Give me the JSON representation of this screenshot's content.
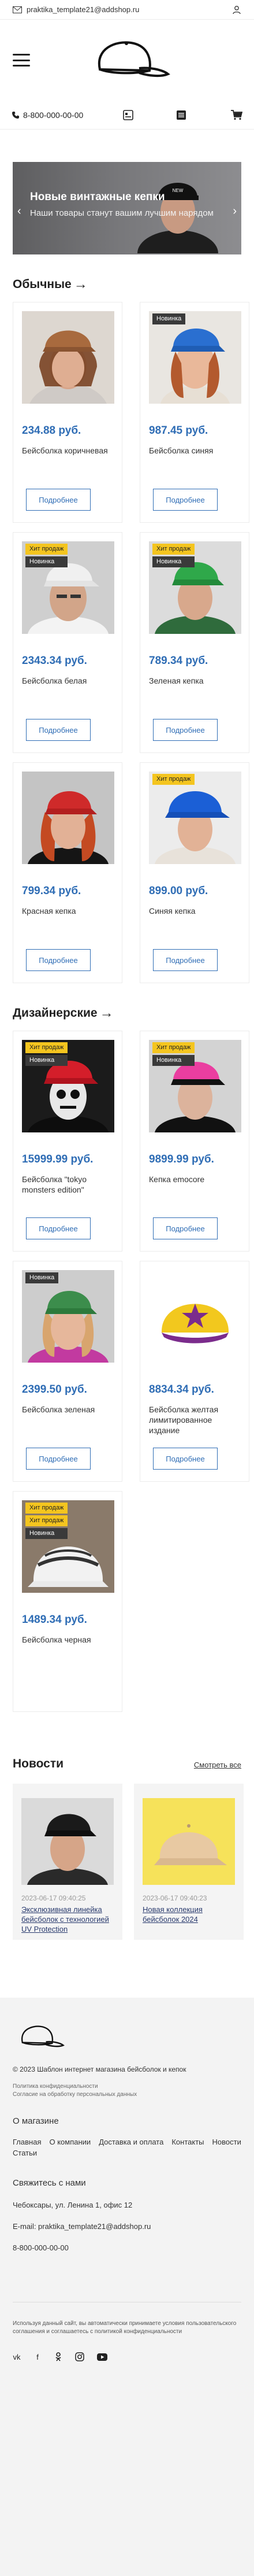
{
  "topbar": {
    "email": "praktika_template21@addshop.ru"
  },
  "header": {
    "phone": "8-800-000-00-00"
  },
  "banner": {
    "title": "Новые винтажные кепки",
    "subtitle": "Наши товары станут вашим лучшим нарядом"
  },
  "sections": {
    "regular_title": "Обычные",
    "designer_title": "Дизайнерские"
  },
  "labels": {
    "more": "Подробнее",
    "new": "Новинка",
    "hit": "Хит продаж"
  },
  "regular_products": [
    {
      "price": "234.88 руб.",
      "name": "Бейсболка коричневая"
    },
    {
      "price": "987.45 руб.",
      "name": "Бейсболка синяя"
    },
    {
      "price": "2343.34 руб.",
      "name": "Бейсболка белая"
    },
    {
      "price": "789.34 руб.",
      "name": "Зеленая кепка"
    },
    {
      "price": "799.34 руб.",
      "name": "Красная кепка"
    },
    {
      "price": "899.00 руб.",
      "name": "Синяя кепка"
    }
  ],
  "designer_products": [
    {
      "price": "15999.99 руб.",
      "name": "Бейсболка \"tokyo monsters edition\""
    },
    {
      "price": "9899.99 руб.",
      "name": "Кепка emocore"
    },
    {
      "price": "2399.50 руб.",
      "name": "Бейсболка зеленая"
    },
    {
      "price": "8834.34 руб.",
      "name": "Бейсболка желтая лимитированное издание"
    },
    {
      "price": "1489.34 руб.",
      "name": "Бейсболка черная"
    }
  ],
  "news": {
    "title": "Новости",
    "see_all": "Смотреть все",
    "items": [
      {
        "date": "2023-06-17 09:40:25",
        "title": "Эксклюзивная линейка бейсболок с технологией UV Protection"
      },
      {
        "date": "2023-06-17 09:40:23",
        "title": "Новая коллекция бейсболок 2024"
      }
    ]
  },
  "footer": {
    "copyright": "© 2023 Шаблон интернет магазина бейсболок и кепок",
    "privacy": "Политика конфиденциальности",
    "consent": "Согласие на обработку персональных данных",
    "about_heading": "О магазине",
    "links": [
      "Главная",
      "О компании",
      "Доставка и оплата",
      "Контакты",
      "Новости",
      "Статьи"
    ],
    "contact_heading": "Свяжитесь с нами",
    "address": "Чебоксары, ул. Ленина 1, офис 12",
    "email": "E-mail: praktika_template21@addshop.ru",
    "phone": "8-800-000-00-00",
    "cookie": "Используя данный сайт, вы автоматически принимаете условия пользовательского соглашения и соглашаетесь с политикой конфиденциальности",
    "socials": [
      "vk",
      "f",
      "ok",
      "ig",
      "yt"
    ]
  },
  "colors": {
    "accent": "#2f6db5",
    "badge_new": "#3a3a3a",
    "badge_hit": "#f4c51f"
  }
}
